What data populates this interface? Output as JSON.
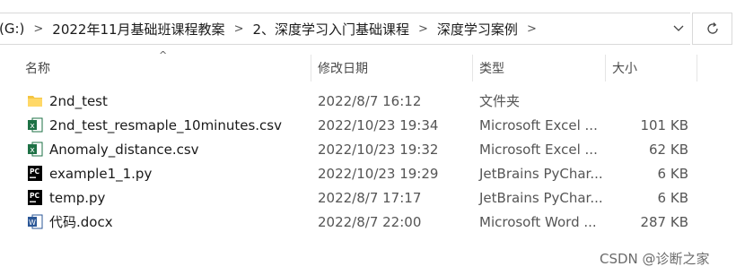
{
  "address_bar": {
    "crumbs": [
      "(G:)",
      "2022年11月基础班课程教案",
      "2、深度学习入门基础课程",
      "深度学习案例"
    ],
    "separator": ">",
    "dropdown_icon": "chevron-down-icon",
    "refresh_icon": "refresh-icon"
  },
  "columns": {
    "name": "名称",
    "modified": "修改日期",
    "type": "类型",
    "size": "大小"
  },
  "files": [
    {
      "name": "2nd_test",
      "modified": "2022/8/7 16:12",
      "type": "文件夹",
      "size": "",
      "icon": "folder-icon"
    },
    {
      "name": "2nd_test_resmaple_10minutes.csv",
      "modified": "2022/10/23 19:34",
      "type": "Microsoft Excel ...",
      "size": "101 KB",
      "icon": "excel-icon"
    },
    {
      "name": "Anomaly_distance.csv",
      "modified": "2022/10/23 19:32",
      "type": "Microsoft Excel ...",
      "size": "62 KB",
      "icon": "excel-icon"
    },
    {
      "name": "example1_1.py",
      "modified": "2022/10/23 19:29",
      "type": "JetBrains PyChar...",
      "size": "6 KB",
      "icon": "pycharm-icon"
    },
    {
      "name": "temp.py",
      "modified": "2022/8/7 17:17",
      "type": "JetBrains PyChar...",
      "size": "6 KB",
      "icon": "pycharm-icon"
    },
    {
      "name": "代码.docx",
      "modified": "2022/8/7 22:00",
      "type": "Microsoft Word ...",
      "size": "287 KB",
      "icon": "word-icon"
    }
  ],
  "watermark": "CSDN @诊断之家",
  "colors": {
    "excel": "#1e7145",
    "word": "#2b5797",
    "pycharm": "#000000",
    "folder": "#f4c542"
  }
}
